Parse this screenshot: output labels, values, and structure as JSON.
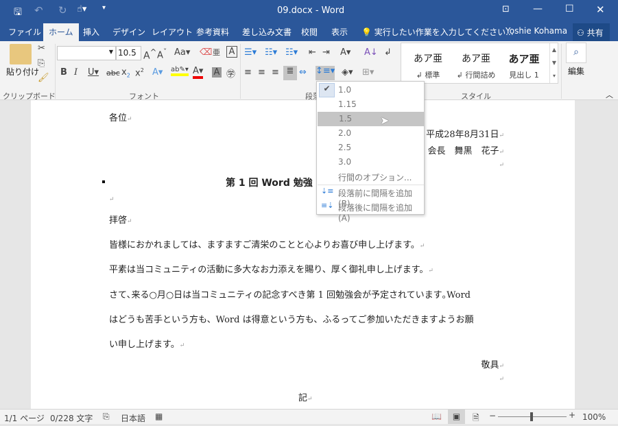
{
  "titlebar": {
    "title": "09.docx - Word",
    "icons": [
      "save-icon",
      "undo-icon",
      "redo-icon",
      "touch-mode-icon",
      "customize-icon",
      "ribbon-display-icon",
      "minimize-icon",
      "maximize-icon",
      "close-icon"
    ]
  },
  "tabs": [
    {
      "label": "ファイル"
    },
    {
      "label": "ホーム",
      "active": true
    },
    {
      "label": "挿入"
    },
    {
      "label": "デザイン"
    },
    {
      "label": "レイアウト"
    },
    {
      "label": "参考資料"
    },
    {
      "label": "差し込み文書"
    },
    {
      "label": "校閲"
    },
    {
      "label": "表示"
    }
  ],
  "tellme": "実行したい作業を入力してください...",
  "user": "Yoshie Kohama",
  "share": "共有",
  "ribbon": {
    "clipboard": {
      "paste": "貼り付け",
      "label": "クリップボード"
    },
    "font": {
      "name": "",
      "size": "10.5",
      "label": "フォント",
      "aa": "Aa"
    },
    "paragraph": {
      "label": "段落"
    },
    "styles": {
      "label": "スタイル",
      "items": [
        {
          "sample": "あア亜",
          "name": "↲ 標準"
        },
        {
          "sample": "あア亜",
          "name": "↲ 行間詰め"
        },
        {
          "sample": "あア亜",
          "name": "見出し 1"
        }
      ]
    },
    "editing": {
      "label": "編集"
    }
  },
  "document": {
    "lines": [
      "各位",
      "平成28年8月31日",
      "会長　舞黒　花子",
      "第 1 回 Word 勉強",
      "拝啓",
      "皆様におかれましては、ますますご清栄のことと心よりお喜び申し上げます。",
      "平素は当コミュニティの活動に多大なお力添えを賜り、厚く御礼申し上げます。",
      "さて､来る○月○日は当コミュニティの記念すべき第 1 回勉強会が予定されています｡Word",
      "はどうも苦手という方も、Word は得意という方も、ふるってご参加いただきますようお願",
      "い申し上げます。",
      "敬具",
      "記"
    ],
    "mark": "↵"
  },
  "line_spacing_menu": {
    "items": [
      "1.0",
      "1.15",
      "1.5",
      "2.0",
      "2.5",
      "3.0"
    ],
    "checked": "1.0",
    "highlighted": "1.5",
    "options": "行間のオプション...",
    "add_before": "段落前に間隔を追加(B)",
    "add_after": "段落後に間隔を追加(A)"
  },
  "status": {
    "page": "1/1 ページ",
    "words": "0/228 文字",
    "language": "日本語",
    "zoom": "100%",
    "zoom_level": 100
  }
}
